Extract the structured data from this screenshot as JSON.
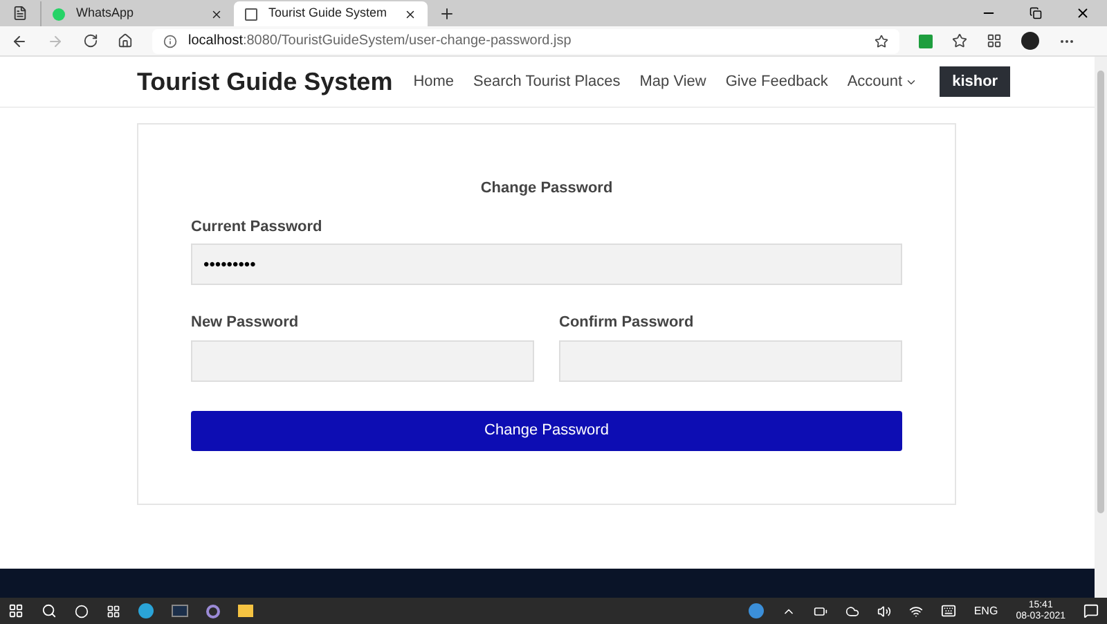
{
  "browser": {
    "tabs": [
      {
        "title": "WhatsApp",
        "selected": false
      },
      {
        "title": "Tourist Guide System",
        "selected": true
      }
    ],
    "address": {
      "host": "localhost",
      "rest": ":8080/TouristGuideSystem/user-change-password.jsp"
    }
  },
  "navbar": {
    "brand": "Tourist Guide System",
    "links": [
      {
        "label": "Home",
        "kind": "link"
      },
      {
        "label": "Search Tourist Places",
        "kind": "link"
      },
      {
        "label": "Map View",
        "kind": "link"
      },
      {
        "label": "Give Feedback",
        "kind": "link"
      },
      {
        "label": "Account",
        "kind": "dropdown"
      }
    ],
    "user": "kishor"
  },
  "form": {
    "title": "Change Password",
    "fields": [
      {
        "label": "Current Password",
        "value": "•••••••••"
      },
      {
        "label": "New Password"
      },
      {
        "label": "Confirm Password"
      }
    ],
    "submit": "Change Password"
  },
  "taskbar": {
    "language": "ENG",
    "time": "15:41",
    "date": "08-03-2021"
  }
}
